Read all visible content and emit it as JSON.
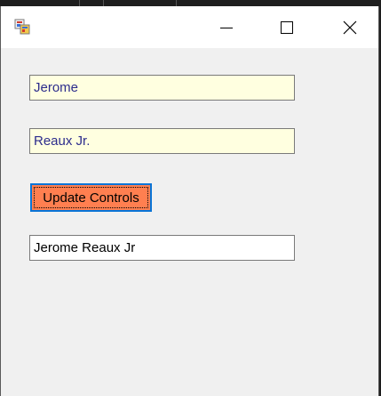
{
  "window": {
    "icon": "winforms-app-icon",
    "controls": {
      "minimize_icon": "minimize-icon",
      "maximize_icon": "maximize-icon",
      "close_icon": "close-icon"
    }
  },
  "form": {
    "first_name_value": "Jerome",
    "last_name_value": "Reaux Jr.",
    "update_button_label": "Update Controls",
    "full_name_value": "Jerome Reaux Jr"
  },
  "colors": {
    "input_highlight": "#ffffe0",
    "button_background": "#ff7f50",
    "focus_border": "#0a74d6",
    "window_background": "#f0f0f0"
  }
}
